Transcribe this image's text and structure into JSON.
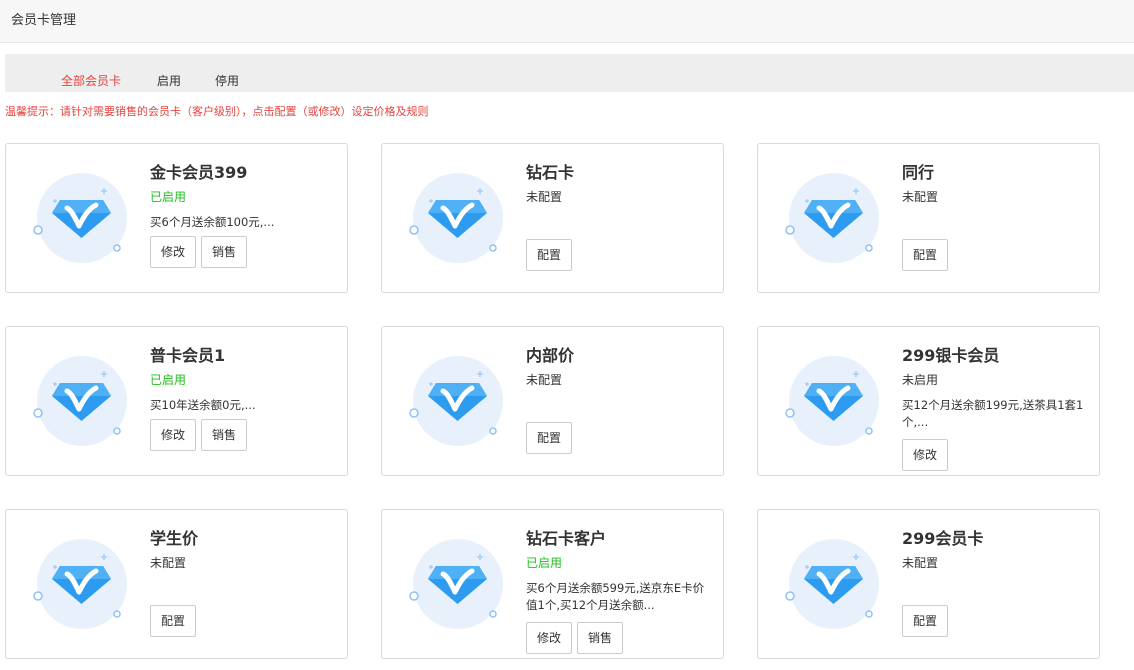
{
  "page": {
    "title": "会员卡管理"
  },
  "tabs": [
    {
      "label": "全部会员卡",
      "active": true
    },
    {
      "label": "启用",
      "active": false
    },
    {
      "label": "停用",
      "active": false
    }
  ],
  "tip": "温馨提示：请针对需要销售的会员卡（客户级别），点击配置（或修改）设定价格及规则",
  "colors": {
    "accent_red": "#e64340",
    "enabled_green": "#1fbf1f",
    "diamond_blue": "#2d9cf0",
    "art_background": "#e8f1fb"
  },
  "icons": {
    "card_art": "blue-diamond-v-icon"
  },
  "cards": [
    {
      "name": "金卡会员399",
      "status": "已启用",
      "status_type": "enabled",
      "rule": "买6个月送余额100元,...",
      "buttons": [
        "修改",
        "销售"
      ]
    },
    {
      "name": "钻石卡",
      "status": "未配置",
      "status_type": "off",
      "rule": "",
      "buttons": [
        "配置"
      ]
    },
    {
      "name": "同行",
      "status": "未配置",
      "status_type": "off",
      "rule": "",
      "buttons": [
        "配置"
      ]
    },
    {
      "name": "普卡会员1",
      "status": "已启用",
      "status_type": "enabled",
      "rule": "买10年送余额0元,...",
      "buttons": [
        "修改",
        "销售"
      ]
    },
    {
      "name": "内部价",
      "status": "未配置",
      "status_type": "off",
      "rule": "",
      "buttons": [
        "配置"
      ]
    },
    {
      "name": "299银卡会员",
      "status": "未启用",
      "status_type": "off",
      "rule": "买12个月送余额199元,送茶具1套1个,...",
      "buttons": [
        "修改"
      ]
    },
    {
      "name": "学生价",
      "status": "未配置",
      "status_type": "off",
      "rule": "",
      "buttons": [
        "配置"
      ]
    },
    {
      "name": "钻石卡客户",
      "status": "已启用",
      "status_type": "enabled",
      "rule": "买6个月送余额599元,送京东E卡价值1个,买12个月送余额...",
      "buttons": [
        "修改",
        "销售"
      ]
    },
    {
      "name": "299会员卡",
      "status": "未配置",
      "status_type": "off",
      "rule": "",
      "buttons": [
        "配置"
      ]
    }
  ]
}
